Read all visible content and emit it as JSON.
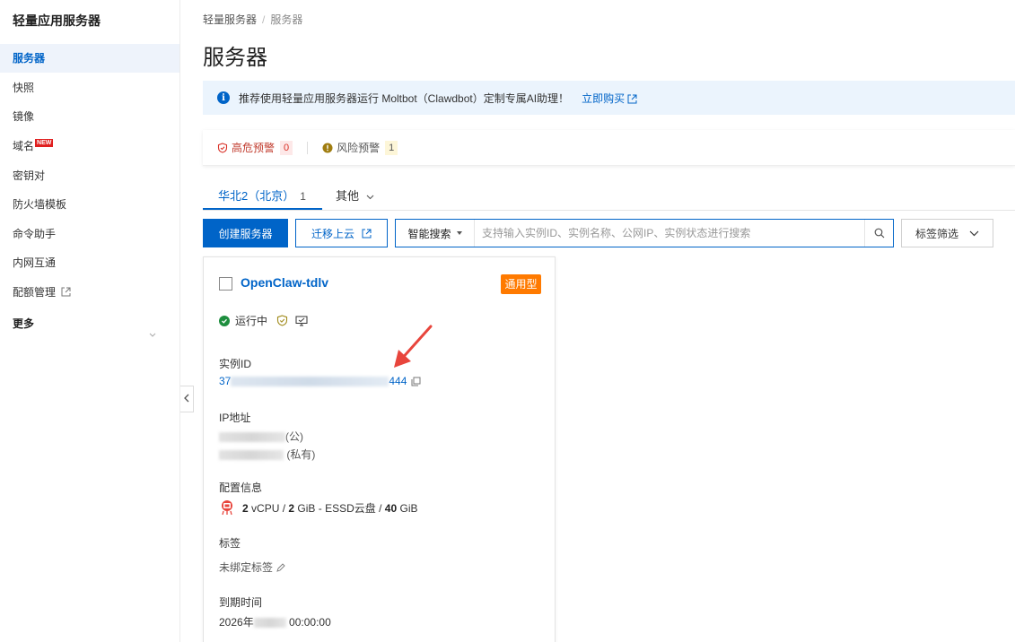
{
  "sidebar": {
    "title": "轻量应用服务器",
    "items": [
      {
        "label": "服务器"
      },
      {
        "label": "快照"
      },
      {
        "label": "镜像"
      },
      {
        "label": "域名",
        "badge": "NEW"
      },
      {
        "label": "密钥对"
      },
      {
        "label": "防火墙模板"
      },
      {
        "label": "命令助手"
      },
      {
        "label": "内网互通"
      },
      {
        "label": "配额管理"
      },
      {
        "label": "更多"
      }
    ]
  },
  "breadcrumb": {
    "root": "轻量服务器",
    "separator": "/",
    "current": "服务器"
  },
  "page_title": "服务器",
  "banner": {
    "text": "推荐使用轻量应用服务器运行 Moltbot（Clawdbot）定制专属AI助理！",
    "link": "立即购买"
  },
  "alerts": {
    "high": {
      "label": "高危预警",
      "count": "0"
    },
    "risk": {
      "label": "风险预警",
      "count": "1"
    }
  },
  "tabs": [
    {
      "label": "华北2（北京）",
      "count": "1"
    },
    {
      "label": "其他"
    }
  ],
  "toolbar": {
    "create_label": "创建服务器",
    "migrate_label": "迁移上云",
    "search_type": "智能搜索",
    "search_placeholder": "支持输入实例ID、实例名称、公网IP、实例状态进行搜索",
    "tag_filter": "标签筛选"
  },
  "card": {
    "name": "OpenClaw-tdlv",
    "type_tag": "通用型",
    "status": "运行中",
    "id_label": "实例ID",
    "id_prefix": "37",
    "id_suffix": "444",
    "ip_label": "IP地址",
    "ip_public_suffix": "(公)",
    "ip_private_suffix": "(私有)",
    "config_label": "配置信息",
    "spec": {
      "vcpu": "2",
      "vcpu_unit": "vCPU /",
      "mem": "2",
      "mem_unit": "GiB - ESSD云盘 /",
      "disk": "40",
      "disk_unit": "GiB"
    },
    "tags_label": "标签",
    "tags_value": "未绑定标签",
    "expire_label": "到期时间",
    "expire_prefix": "2026年",
    "expire_suffix": "00:00:00"
  },
  "colors": {
    "primary": "#0064c8",
    "active_bg": "#eef3fb",
    "banner_bg": "#ebf4fd",
    "tag_orange": "#ff7a00",
    "arrow_red": "#e8453c",
    "ok_green": "#1e8e3e"
  }
}
